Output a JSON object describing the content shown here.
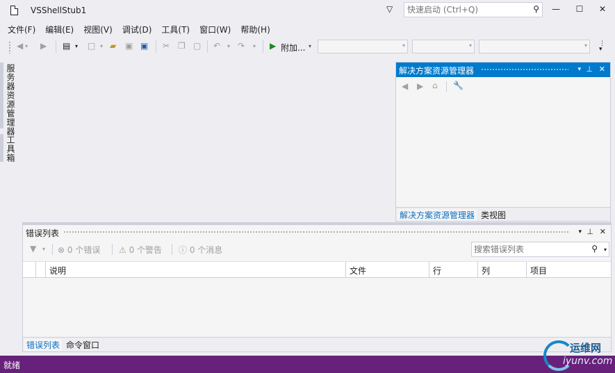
{
  "window": {
    "title": "VSShellStub1",
    "quick_launch_placeholder": "快速启动 (Ctrl+Q)",
    "min_glyph": "—",
    "max_glyph": "☐",
    "close_glyph": "✕"
  },
  "menu": [
    "文件(F)",
    "编辑(E)",
    "视图(V)",
    "调试(D)",
    "工具(T)",
    "窗口(W)",
    "帮助(H)"
  ],
  "toolbar": {
    "attach_label": "附加..."
  },
  "left_tabs": {
    "server_explorer": "服务器资源管理器",
    "toolbox": "工具箱"
  },
  "solution_explorer": {
    "title": "解决方案资源管理器",
    "tabs": [
      "解决方案资源管理器",
      "类视图"
    ]
  },
  "error_list": {
    "title": "错误列表",
    "errors_label": "0 个错误",
    "warnings_label": "0 个警告",
    "messages_label": "0 个消息",
    "search_placeholder": "搜索错误列表",
    "columns": [
      "说明",
      "文件",
      "行",
      "列",
      "项目"
    ],
    "tabs": [
      "错误列表",
      "命令窗口"
    ]
  },
  "status": {
    "text": "就绪"
  },
  "watermark": {
    "name": "运维网",
    "url": "iyunv.com"
  },
  "colors": {
    "accent": "#007acc",
    "status_bar": "#68217a"
  }
}
